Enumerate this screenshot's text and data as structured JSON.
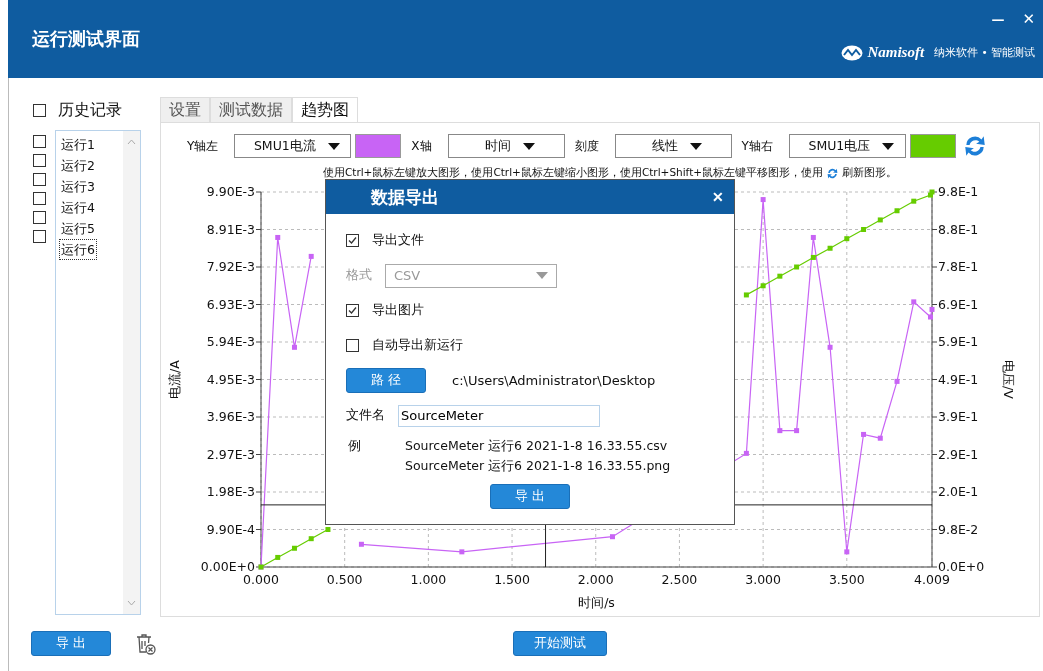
{
  "window": {
    "title": "运行测试界面",
    "logo": "Namisoft",
    "tagline": "纳米软件 • 智能测试",
    "controls": [
      {
        "kind": "minimize",
        "label": "—"
      },
      {
        "kind": "close",
        "label": "✕"
      }
    ]
  },
  "history": {
    "label": "历史记录",
    "checked": false,
    "runs": [
      {
        "label": "运行1",
        "checked": false,
        "selected": false
      },
      {
        "label": "运行2",
        "checked": false,
        "selected": false
      },
      {
        "label": "运行3",
        "checked": false,
        "selected": false
      },
      {
        "label": "运行4",
        "checked": false,
        "selected": false
      },
      {
        "label": "运行5",
        "checked": false,
        "selected": false
      },
      {
        "label": "运行6",
        "checked": false,
        "selected": true
      }
    ]
  },
  "tabs": [
    {
      "label": "设置",
      "selected": false
    },
    {
      "label": "测试数据",
      "selected": false
    },
    {
      "label": "趋势图",
      "selected": true
    }
  ],
  "toolbar": [
    {
      "kind": "series",
      "label": "Y轴左",
      "color": "#c864f5"
    },
    {
      "kind": "select",
      "label": "X轴",
      "value": "时间"
    },
    {
      "kind": "select",
      "label": "刻度",
      "value": "线性"
    },
    {
      "kind": "series",
      "label": "Y轴右",
      "color": "#66cc00"
    }
  ],
  "hint": {
    "before": "使用Ctrl+鼠标左键放大图形，使用Ctrl+鼠标左键缩小图形，使用Ctrl+Shift+鼠标左键平移图形，使用",
    "after": "刷新图形。"
  },
  "chart": {
    "chart_data": {
      "type": "line",
      "xlabel": "时间/s",
      "ylabel": "电流/A",
      "y2label": "电压/V",
      "x": [
        0,
        0.1,
        0.2,
        0.3,
        0.4,
        0.6,
        1.2,
        2.1,
        2.9,
        3.0,
        3.1,
        3.2,
        3.3,
        3.4,
        3.5,
        3.6,
        3.7,
        3.8,
        3.9,
        4.0,
        4.009
      ],
      "series": [
        {
          "name": "SMU1电流",
          "color": "#c864f5",
          "marker": "square",
          "values": [
            0,
            0.0087,
            0.0058,
            0.0082,
            null,
            0.0006,
            0.0004,
            0.0008,
            0.003,
            0.0097,
            0.0036,
            0.0036,
            0.0087,
            0.0058,
            0.0004,
            0.0035,
            0.0034,
            0.0049,
            0.007,
            0.0066,
            0.0068
          ]
        },
        {
          "name": "SMU1电压",
          "color": "#66cc00",
          "axis": "y2",
          "marker": "square",
          "values": [
            0,
            0.025,
            0.049,
            0.074,
            0.098,
            null,
            null,
            null,
            0.711,
            0.735,
            0.76,
            0.784,
            0.809,
            0.833,
            0.858,
            0.882,
            0.907,
            0.931,
            0.956,
            0.972,
            0.98
          ]
        }
      ],
      "grid": true,
      "ref_lines": [
        {
          "axis": "y",
          "value": 0.00164
        },
        {
          "axis": "x",
          "value": 1.7
        }
      ],
      "xlim": [
        0,
        4.009
      ],
      "ylim": [
        0,
        0.0099
      ],
      "y2lim": [
        0,
        0.98
      ],
      "xticks": [
        {
          "value": 0,
          "label": "0.000"
        },
        {
          "value": 0.5,
          "label": "0.500"
        },
        {
          "value": 1,
          "label": "1.000"
        },
        {
          "value": 1.5,
          "label": "1.500"
        },
        {
          "value": 2,
          "label": "2.000"
        },
        {
          "value": 2.5,
          "label": "2.500"
        },
        {
          "value": 3,
          "label": "3.000"
        },
        {
          "value": 3.5,
          "label": "3.500"
        },
        {
          "value": 4.009,
          "label": "4.009"
        }
      ],
      "yticks": [
        {
          "value": 0,
          "label": "0.00E+0"
        },
        {
          "value": 0.00099,
          "label": "9.90E-4"
        },
        {
          "value": 0.00198,
          "label": "1.98E-3"
        },
        {
          "value": 0.00297,
          "label": "2.97E-3"
        },
        {
          "value": 0.00396,
          "label": "3.96E-3"
        },
        {
          "value": 0.00495,
          "label": "4.95E-3"
        },
        {
          "value": 0.00594,
          "label": "5.94E-3"
        },
        {
          "value": 0.00693,
          "label": "6.93E-3"
        },
        {
          "value": 0.00792,
          "label": "7.92E-3"
        },
        {
          "value": 0.00891,
          "label": "8.91E-3"
        },
        {
          "value": 0.0099,
          "label": "9.90E-3"
        }
      ],
      "y2ticks": [
        {
          "value": 0,
          "label": "0.0E+0"
        },
        {
          "value": 0.098,
          "label": "9.8E-2"
        },
        {
          "value": 0.196,
          "label": "2.0E-1"
        },
        {
          "value": 0.294,
          "label": "2.9E-1"
        },
        {
          "value": 0.392,
          "label": "3.9E-1"
        },
        {
          "value": 0.49,
          "label": "4.9E-1"
        },
        {
          "value": 0.588,
          "label": "5.9E-1"
        },
        {
          "value": 0.686,
          "label": "6.9E-1"
        },
        {
          "value": 0.784,
          "label": "7.8E-1"
        },
        {
          "value": 0.882,
          "label": "8.8E-1"
        },
        {
          "value": 0.98,
          "label": "9.8E-1"
        }
      ]
    }
  },
  "dialog": {
    "title": "数据导出",
    "close": "✕",
    "options": [
      {
        "kind": "checkbox",
        "label": "导出文件",
        "checked": true
      },
      {
        "kind": "select",
        "label": "格式",
        "value": "CSV",
        "disabled": true
      },
      {
        "kind": "checkbox",
        "label": "导出图片",
        "checked": true
      },
      {
        "kind": "checkbox",
        "label": "自动导出新运行",
        "checked": false
      }
    ],
    "path_button": "路 径",
    "path": "c:\\Users\\Administrator\\Desktop",
    "filename_label": "文件名",
    "filename": "SourceMeter",
    "example_label": "例",
    "examples": [
      "SourceMeter 运行6 2021-1-8 16.33.55.csv",
      "SourceMeter 运行6 2021-1-8 16.33.55.png"
    ],
    "export_button": "导 出"
  },
  "footer": {
    "export_button": "导 出",
    "start_button": "开始测试"
  }
}
